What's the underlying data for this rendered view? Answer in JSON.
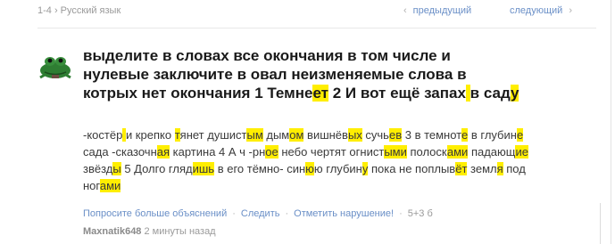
{
  "header": {
    "breadcrumb": "1-4 › Русский язык",
    "prev_label": "предыдущий",
    "next_label": "следующий",
    "prev_arrow": "‹",
    "next_arrow": "›"
  },
  "question": {
    "title_parts": [
      {
        "t": "выделите в словах все окончания в том числе и нулевые заключите в овал неизменяемые слова в котрых нет окончания 1 Темне"
      },
      {
        "t": "ет",
        "h": true
      },
      {
        "t": " 2 И вот ещё запах"
      },
      {
        "t": " ",
        "h": true
      },
      {
        "t": "в сад"
      },
      {
        "t": "у",
        "h": true
      }
    ]
  },
  "answer": {
    "parts": [
      {
        "t": "-костёр"
      },
      {
        "t": " ",
        "h": true
      },
      {
        "t": "и крепко "
      },
      {
        "t": "т",
        "h": true
      },
      {
        "t": "янет душист"
      },
      {
        "t": "ым",
        "h": true
      },
      {
        "t": " дым"
      },
      {
        "t": "ом",
        "h": true
      },
      {
        "t": " вишнёв"
      },
      {
        "t": "ых",
        "h": true
      },
      {
        "t": " сучь"
      },
      {
        "t": "ев",
        "h": true
      },
      {
        "t": " 3 в темнот"
      },
      {
        "t": "е",
        "h": true
      },
      {
        "t": " в глубин"
      },
      {
        "t": "е",
        "h": true
      },
      {
        "t": " сада -сказочн"
      },
      {
        "t": "ая",
        "h": true
      },
      {
        "t": " картина 4 А ч -рн"
      },
      {
        "t": "ое",
        "h": true
      },
      {
        "t": " небо чертят огнист"
      },
      {
        "t": "ыми",
        "h": true
      },
      {
        "t": " полоск"
      },
      {
        "t": "ами",
        "h": true
      },
      {
        "t": " падающ"
      },
      {
        "t": "ие",
        "h": true
      },
      {
        "t": " звёзд"
      },
      {
        "t": "ы",
        "h": true
      },
      {
        "t": " 5 Долго гляд"
      },
      {
        "t": "ишь",
        "h": true
      },
      {
        "t": " в его тёмно- син"
      },
      {
        "t": "ю",
        "h": true
      },
      {
        "t": "ю глубин"
      },
      {
        "t": "у",
        "h": true
      },
      {
        "t": " пока не поплыв"
      },
      {
        "t": "ёт",
        "h": true
      },
      {
        "t": " земл"
      },
      {
        "t": "я",
        "h": true
      },
      {
        "t": " под ног"
      },
      {
        "t": "ами",
        "h": true
      }
    ],
    "highlight_color": "#ffee00"
  },
  "actions": {
    "more_explanations": "Попросите больше объяснений",
    "follow": "Следить",
    "report": "Отметить нарушение!",
    "points": "5+3 б"
  },
  "meta": {
    "username": "Maxnatik648",
    "time": "2 минуты назад"
  },
  "colors": {
    "link": "#6a8fc7",
    "muted": "#9a9a9a",
    "highlight": "#ffee00"
  },
  "icons": {
    "avatar": "frog-avatar-icon"
  }
}
